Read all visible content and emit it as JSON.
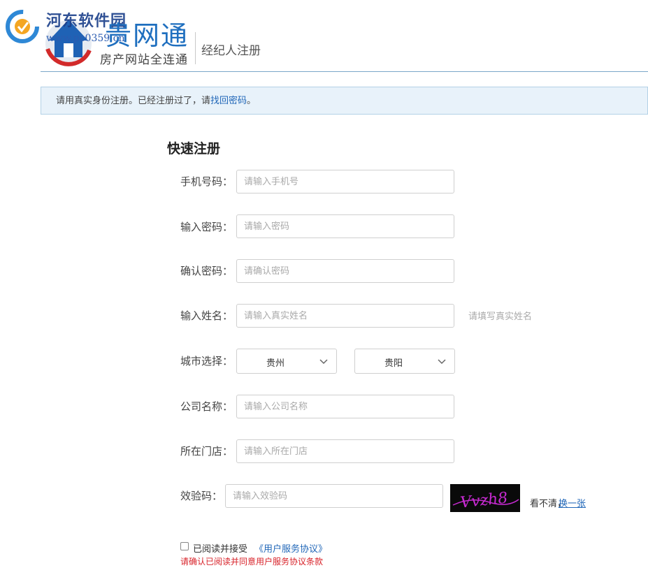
{
  "watermark": {
    "site_name": "河东软件园",
    "url": "www.pc0359.cn"
  },
  "brand": {
    "name": "贵网通",
    "slogan": "房产网站全连通"
  },
  "header": {
    "page_title": "经纪人注册"
  },
  "notice": {
    "text_before": "请用真实身份注册。已经注册过了，请",
    "link_text": "找回密码",
    "text_after": "。"
  },
  "form": {
    "title": "快速注册",
    "fields": {
      "phone": {
        "label": "手机号码：",
        "placeholder": "请输入手机号",
        "value": ""
      },
      "password": {
        "label": "输入密码：",
        "placeholder": "请输入密码",
        "value": ""
      },
      "confirm": {
        "label": "确认密码：",
        "placeholder": "请确认密码",
        "value": ""
      },
      "name": {
        "label": "输入姓名：",
        "placeholder": "请输入真实姓名",
        "value": "",
        "hint": "请填写真实姓名"
      },
      "city": {
        "label": "城市选择：",
        "province": "贵州",
        "city": "贵阳"
      },
      "company": {
        "label": "公司名称：",
        "placeholder": "请输入公司名称",
        "value": ""
      },
      "store": {
        "label": "所在门店：",
        "placeholder": "请输入所在门店",
        "value": ""
      },
      "captcha": {
        "label": "效验码：",
        "placeholder": "请输入效验码",
        "value": "",
        "unclear_text": "看不清，",
        "refresh_link": "换一张"
      }
    },
    "agreement": {
      "checked": false,
      "text": "已阅读并接受",
      "link_text": "《用户服务协议》",
      "error": "请确认已阅读并同意用户服务协议条款"
    }
  },
  "colors": {
    "accent_blue": "#2167b8",
    "notice_bg": "#e8f2fa",
    "error_red": "#d8232a",
    "captcha_bg": "#0a0a0a",
    "captcha_ink": "#c62ad0"
  },
  "icons": {
    "watermark_logo": "circular-arrow-logo-icon",
    "brand_logo": "house-icon",
    "select_arrow": "chevron-down-icon"
  }
}
